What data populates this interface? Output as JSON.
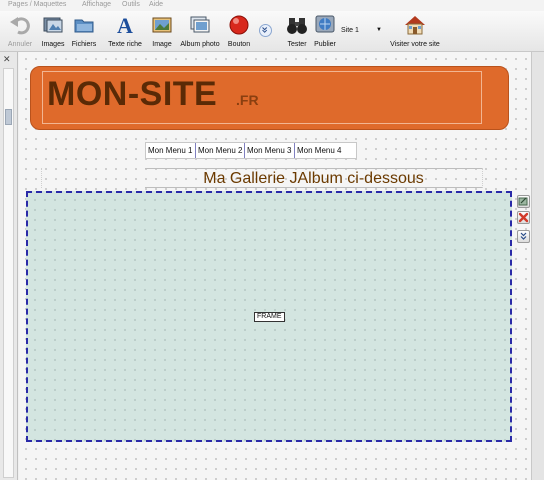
{
  "menubar": {
    "items": [
      "Pages / Maquettes",
      "Affichage",
      "Outils",
      "Aide"
    ]
  },
  "toolbar": {
    "buttons": [
      {
        "label": "Annuler",
        "icon": "undo-icon"
      },
      {
        "label": "Images",
        "icon": "images-icon"
      },
      {
        "label": "Fichiers",
        "icon": "files-icon"
      },
      {
        "label": "Texte riche",
        "icon": "rich-text-icon"
      },
      {
        "label": "Image",
        "icon": "image-icon"
      },
      {
        "label": "Album photo",
        "icon": "photo-album-icon"
      },
      {
        "label": "Bouton",
        "icon": "button-icon"
      },
      {
        "label": "Tester",
        "icon": "binoculars-icon"
      },
      {
        "label": "Publier",
        "icon": "publish-icon"
      },
      {
        "label": "Visiter votre site",
        "icon": "home-icon"
      }
    ],
    "more_icon": "chevron-double-down-icon",
    "site_select": {
      "value": "Site 1"
    }
  },
  "canvas": {
    "logo": {
      "main": "MON-SITE",
      "tld": ".FR"
    },
    "menu_items": [
      "Mon Menu 1",
      "Mon Menu 2",
      "Mon Menu 3",
      "Mon Menu 4"
    ],
    "title": "Ma Gallerie JAlbum ci-dessous",
    "frame_label": "FRAME"
  },
  "colors": {
    "banner": "#df6a2b",
    "logo_text": "#5a2a06",
    "title_text": "#6b3a00",
    "frame_bg": "#d3e5e0",
    "frame_border": "#2a2aa8",
    "delete_red": "#d23a2a"
  }
}
